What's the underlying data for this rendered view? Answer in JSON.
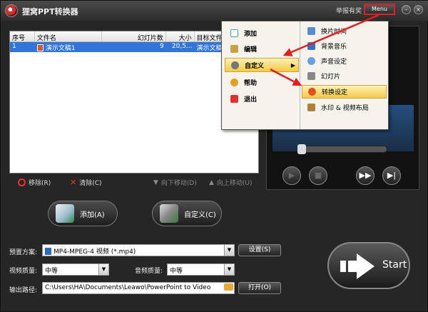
{
  "app": {
    "title": "狸窝PPT转换器",
    "report_link": "举报有奖",
    "menu_label": "Menu",
    "window_controls": {
      "minimize": "–",
      "close": "×"
    }
  },
  "file_list": {
    "columns": [
      "序号",
      "文件名",
      "幻灯片数",
      "大小",
      "目标文件名"
    ],
    "rows": [
      {
        "index": "1",
        "name": "演示文稿1",
        "slides": "9",
        "size": "20,5...",
        "target": "演示文稿1"
      }
    ]
  },
  "list_actions": {
    "remove": "移除(R)",
    "clear": "清除(C)",
    "move_down": "向下移动(D)",
    "move_up": "向上移动(U)"
  },
  "buttons": {
    "add": "添加(A)",
    "customize": "自定义(C)",
    "settings": "设置(S)",
    "open": "打开(O)",
    "start": "Start"
  },
  "settings": {
    "preset_label": "预置方案:",
    "preset_value": "MP4-MPEG-4 视频 (*.mp4)",
    "video_quality_label": "视频质量:",
    "video_quality_value": "中等",
    "audio_quality_label": "音频质量:",
    "audio_quality_value": "中等",
    "output_label": "输出路径:",
    "output_value": "C:\\Users\\HA\\Documents\\Leawo\\PowerPoint to Video"
  },
  "player": {
    "controls": [
      "play",
      "stop",
      "fast-forward",
      "next"
    ]
  },
  "menu": {
    "items": [
      {
        "label": "添加",
        "icon": "add-icon"
      },
      {
        "label": "编辑",
        "icon": "edit-icon"
      },
      {
        "label": "自定义",
        "icon": "gear-icon",
        "selected": true
      },
      {
        "label": "帮助",
        "icon": "help-icon"
      },
      {
        "label": "退出",
        "icon": "exit-icon"
      }
    ],
    "submenu": [
      {
        "label": "换片时间",
        "icon": "user-icon"
      },
      {
        "label": "背景音乐",
        "icon": "music-icon"
      },
      {
        "label": "声音设定",
        "icon": "sound-icon"
      },
      {
        "label": "幻灯片",
        "icon": "slide-icon"
      },
      {
        "label": "转换设定",
        "icon": "convert-icon",
        "selected": true
      },
      {
        "label": "水印 & 视频布局",
        "icon": "watermark-icon"
      }
    ]
  },
  "colors": {
    "selection_blue": "#3375d6",
    "annotation_red": "#e02020",
    "menu_highlight": "#f3c845"
  }
}
